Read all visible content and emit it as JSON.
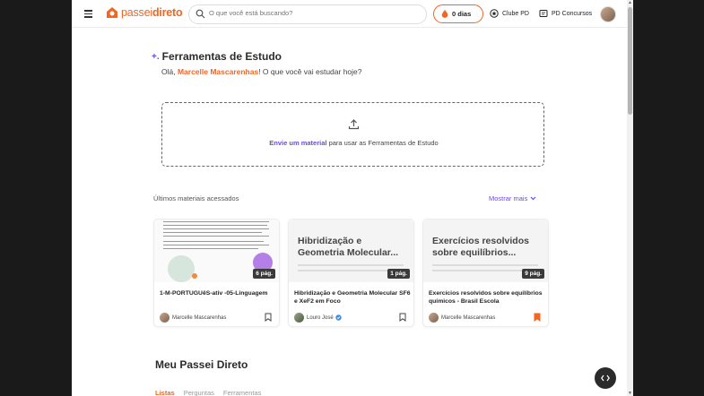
{
  "header": {
    "logo_light": "passei",
    "logo_bold": "direto",
    "search_placeholder": "O que você está buscando?",
    "streak_label": "0 dias",
    "club_label": "Clube PD",
    "concursos_label": "PD Concursos"
  },
  "tools": {
    "title": "Ferramentas de Estudo",
    "greeting_prefix": "Olá, ",
    "user_name": "Marcelle Mascarenhas",
    "greeting_suffix": "! O que você vai estudar hoje?",
    "upload_link": "Envie um material",
    "upload_rest": " para usar as Ferramentas de Estudo"
  },
  "recent": {
    "header": "Últimos materiais acessados",
    "show_more": "Mostrar mais",
    "cards": [
      {
        "thumb_title": "",
        "pages": "6 pág.",
        "title": "1-M-PORTUGUêS-ativ -05-Linguagem",
        "author": "Marcelle Mascarenhas",
        "bookmarked": false
      },
      {
        "thumb_title": "Hibridização e Geometria Molecular...",
        "pages": "1 pág.",
        "title": "Hibridização e Geometria Molecular SF6 e XeF2 em Foco",
        "author": "Louro José",
        "bookmarked": false
      },
      {
        "thumb_title": "Exercícios resolvidos sobre equilíbrios...",
        "pages": "9 pág.",
        "title": "Exercícios resolvidos sobre equilíbrios químicos - Brasil Escola",
        "author": "Marcelle Mascarenhas",
        "bookmarked": true
      }
    ]
  },
  "my_section": {
    "title": "Meu Passei Direto",
    "tabs": [
      "Listas",
      "Perguntas",
      "Ferramentas"
    ]
  },
  "colors": {
    "brand": "#f26522",
    "accent": "#6b4bd8"
  }
}
